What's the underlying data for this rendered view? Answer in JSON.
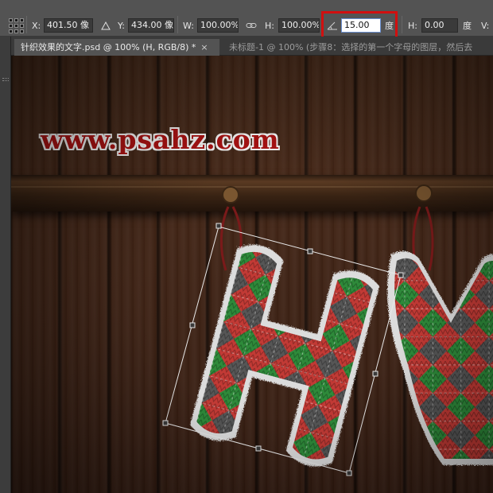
{
  "options_bar": {
    "reference_point_icon": "reference-point-grid-icon",
    "x_label": "X:",
    "x_value": "401.50 像",
    "delta_icon": "delta-triangle-icon",
    "y_label": "Y:",
    "y_value": "434.00 像",
    "w_label": "W:",
    "w_value": "100.00%",
    "link_icon": "chain-link-icon",
    "h_label": "H:",
    "h_value": "100.00%",
    "angle_icon": "angle-icon",
    "angle_value": "15.00",
    "angle_unit": "度",
    "skew_h_label": "H:",
    "skew_h_value": "0.00",
    "skew_h_unit": "度",
    "skew_v_label": "V:",
    "highlight_color": "#d10f0f"
  },
  "tabs": [
    {
      "label": "针织效果的文字.psd @ 100% (H, RGB/8) *",
      "close": "×"
    },
    {
      "label": "未标题-1 @ 100% (步骤8：选择的第一个字母的图层，然后去"
    }
  ],
  "canvas": {
    "watermark": "www.psahz.com",
    "watermark_color": "#b01313"
  }
}
